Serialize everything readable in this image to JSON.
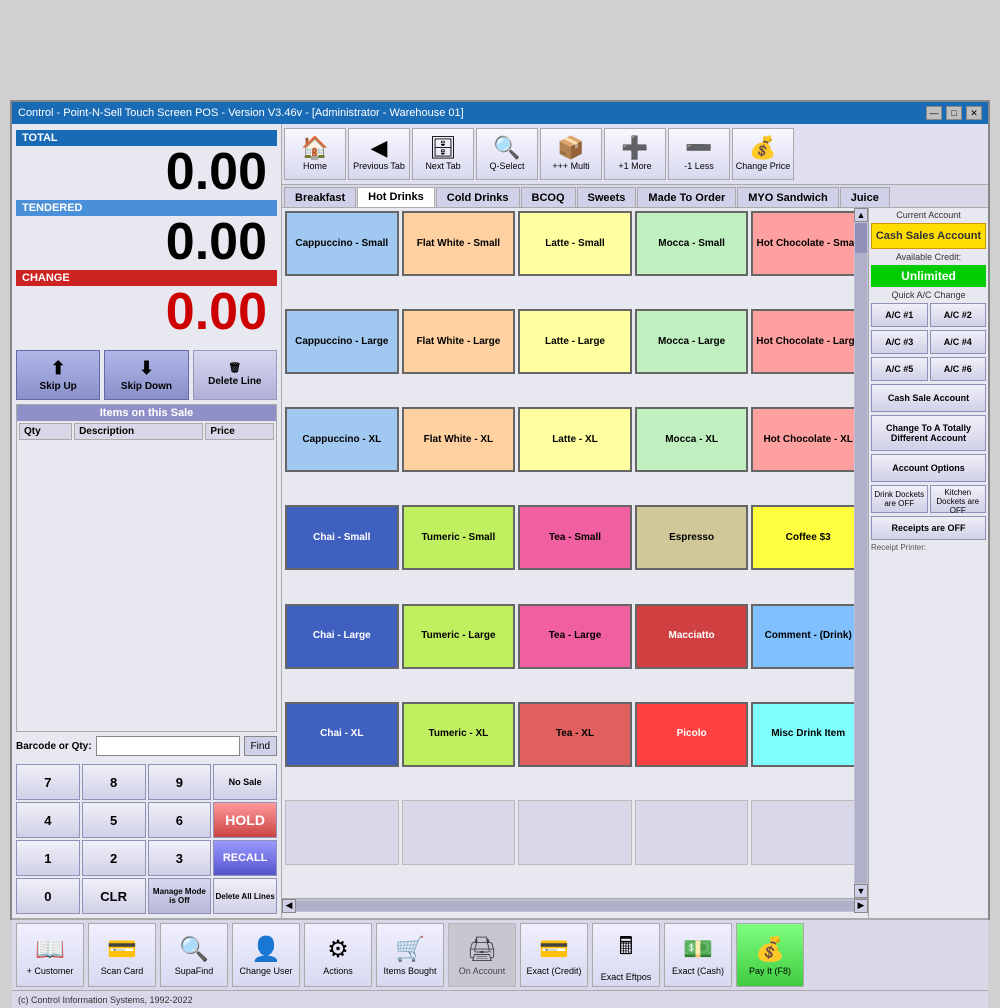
{
  "title_bar": {
    "title": "Control - Point-N-Sell Touch Screen POS - Version V3.46v - [Administrator - Warehouse 01]",
    "minimize": "—",
    "maximize": "□",
    "close": "✕"
  },
  "left": {
    "total_label": "TOTAL",
    "total_amount": "0.00",
    "tendered_label": "TENDERED",
    "tendered_amount": "0.00",
    "change_label": "CHANGE",
    "change_amount": "0.00",
    "skip_up": "Skip Up",
    "skip_down": "Skip Down",
    "delete_line": "Delete Line",
    "items_header": "Items on this Sale",
    "col_qty": "Qty",
    "col_desc": "Description",
    "col_price": "Price",
    "barcode_label": "Barcode or Qty:",
    "find_btn": "Find",
    "numpad": [
      "7",
      "8",
      "9",
      "4",
      "5",
      "6",
      "1",
      "2",
      "3",
      "0"
    ],
    "no_sale": "No Sale",
    "hold": "HOLD",
    "manage": "Manage Mode is Off",
    "recall": "RECALL",
    "clr": "CLR",
    "delete_all": "Delete All Lines"
  },
  "toolbar": {
    "home": "Home",
    "previous_tab": "Previous Tab",
    "next_tab": "Next Tab",
    "q_select": "Q-Select",
    "multi": "+++ Multi",
    "more": "+1 More",
    "less": "-1 Less",
    "change_price": "Change Price"
  },
  "categories": [
    {
      "label": "Breakfast",
      "active": false
    },
    {
      "label": "Hot Drinks",
      "active": true
    },
    {
      "label": "Cold Drinks",
      "active": false
    },
    {
      "label": "BCOQ",
      "active": false
    },
    {
      "label": "Sweets",
      "active": false
    },
    {
      "label": "Made To Order",
      "active": false
    },
    {
      "label": "MYO Sandwich",
      "active": false
    },
    {
      "label": "Juice",
      "active": false
    }
  ],
  "products": [
    {
      "label": "Cappuccino - Small",
      "style": "cappuccino"
    },
    {
      "label": "Flat White - Small",
      "style": "flat-white"
    },
    {
      "label": "Latte - Small",
      "style": "latte"
    },
    {
      "label": "Mocca - Small",
      "style": "mocca"
    },
    {
      "label": "Hot Chocolate - Small",
      "style": "hot-choc"
    },
    {
      "label": "Cappuccino - Large",
      "style": "cappuccino"
    },
    {
      "label": "Flat White - Large",
      "style": "flat-white"
    },
    {
      "label": "Latte - Large",
      "style": "latte"
    },
    {
      "label": "Mocca - Large",
      "style": "mocca"
    },
    {
      "label": "Hot Chocolate - Large",
      "style": "hot-choc"
    },
    {
      "label": "Cappuccino - XL",
      "style": "cappuccino"
    },
    {
      "label": "Flat White - XL",
      "style": "flat-white"
    },
    {
      "label": "Latte - XL",
      "style": "latte"
    },
    {
      "label": "Mocca - XL",
      "style": "mocca"
    },
    {
      "label": "Hot Chocolate - XL",
      "style": "hot-choc"
    },
    {
      "label": "Chai - Small",
      "style": "chai"
    },
    {
      "label": "Tumeric - Small",
      "style": "tumeric"
    },
    {
      "label": "Tea - Small",
      "style": "tea"
    },
    {
      "label": "Espresso",
      "style": "espresso"
    },
    {
      "label": "Coffee $3",
      "style": "coffee3"
    },
    {
      "label": "Chai - Large",
      "style": "chai"
    },
    {
      "label": "Tumeric - Large",
      "style": "tumeric"
    },
    {
      "label": "Tea - Large",
      "style": "tea"
    },
    {
      "label": "Macciatto",
      "style": "macciatto"
    },
    {
      "label": "Comment - (Drink)",
      "style": "comment"
    },
    {
      "label": "Chai - XL",
      "style": "chai-xl"
    },
    {
      "label": "Tumeric - XL",
      "style": "tumeric-xl"
    },
    {
      "label": "Tea - XL",
      "style": "tea-xl"
    },
    {
      "label": "Picolo",
      "style": "picolo"
    },
    {
      "label": "Misc Drink Item",
      "style": "misc"
    },
    {
      "label": "",
      "style": "empty"
    },
    {
      "label": "",
      "style": "empty"
    },
    {
      "label": "",
      "style": "empty"
    },
    {
      "label": "",
      "style": "empty"
    },
    {
      "label": "",
      "style": "empty"
    }
  ],
  "right_panel": {
    "current_account": "Current Account",
    "cash_sales_account": "Cash Sales Account",
    "available_credit": "Available Credit:",
    "unlimited": "Unlimited",
    "quick_ac_change": "Quick A/C Change",
    "ac_buttons": [
      "A/C #1",
      "A/C #2",
      "A/C #3",
      "A/C #4",
      "A/C #5",
      "A/C #6"
    ],
    "cash_sale_account": "Cash Sale Account",
    "change_account": "Change To A Totally Different Account",
    "account_options": "Account Options",
    "drink_dockets": "Drink Dockets are OFF",
    "kitchen_dockets": "Kitchen Dockets are OFF",
    "receipts": "Receipts are OFF",
    "receipt_printer": "Receipt Printer:"
  },
  "bottom": {
    "customer": "+ Customer",
    "scan_card": "Scan Card",
    "supa_find": "SupaFind",
    "change_user": "Change User",
    "actions": "Actions",
    "items_bought": "Items Bought",
    "on_account": "On Account",
    "exact_credit": "Exact (Credit)",
    "exact_eftpos": "Exact Eftpos",
    "exact_cash": "Exact (Cash)",
    "pay_it": "Pay It (F8)"
  },
  "status_bar": {
    "text": "(c) Control Information Systems, 1992-2022"
  }
}
